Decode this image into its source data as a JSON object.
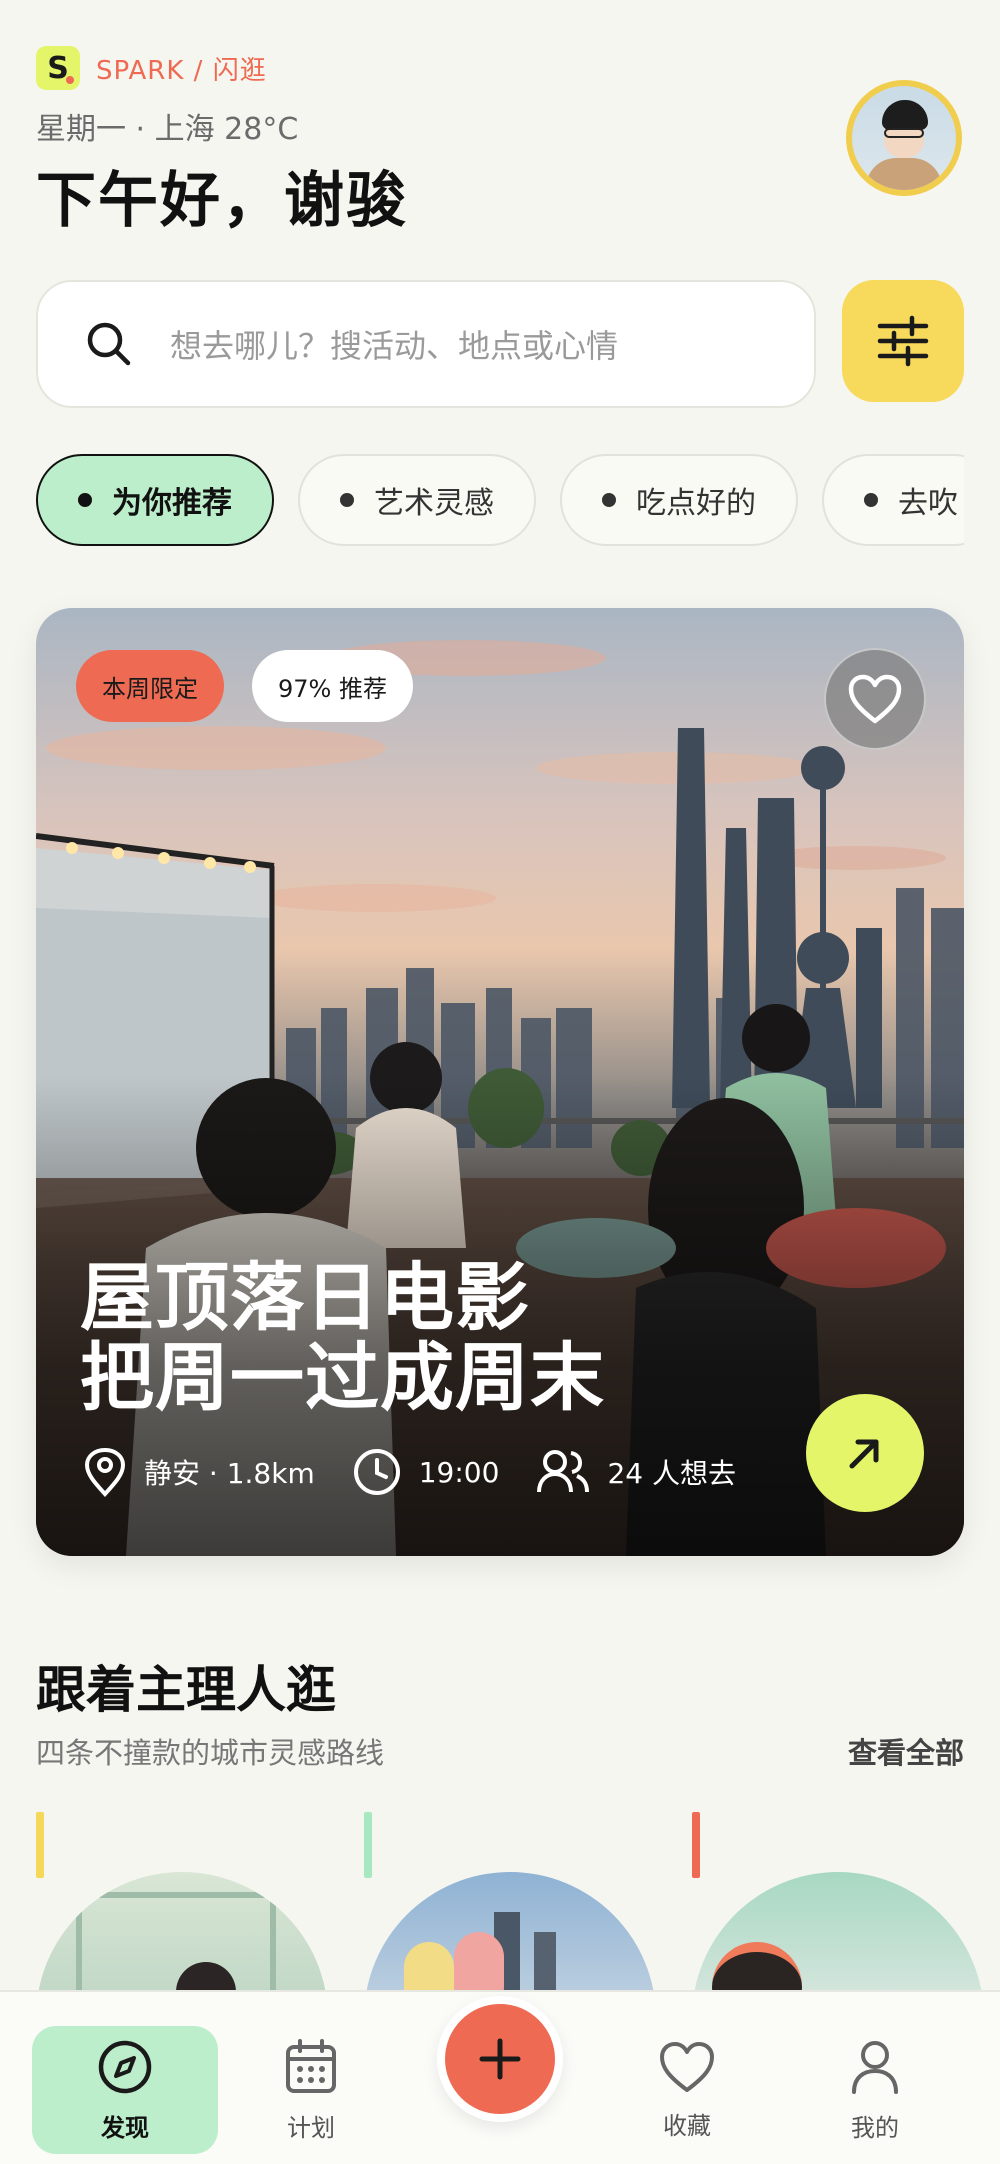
{
  "brand": {
    "name": "SPARK / 闪逛",
    "logo_letter": "S"
  },
  "header": {
    "meta": "星期一 · 上海 28°C",
    "greeting": "下午好，谢骏"
  },
  "search": {
    "placeholder": "想去哪儿？搜活动、地点或心情"
  },
  "chips": [
    {
      "label": "为你推荐",
      "active": true
    },
    {
      "label": "艺术灵感",
      "active": false
    },
    {
      "label": "吃点好的",
      "active": false
    },
    {
      "label": "去吹",
      "active": false
    }
  ],
  "hero": {
    "badge_limited": "本周限定",
    "badge_rec": "97% 推荐",
    "title_line1": "屋顶落日电影",
    "title_line2": "把周一过成周末",
    "location": "静安 · 1.8km",
    "time": "19:00",
    "people": "24 人想去"
  },
  "section": {
    "title": "跟着主理人逛",
    "subtitle": "四条不撞款的城市灵感路线",
    "more": "查看全部"
  },
  "guides": [
    {
      "accent": "#f5d85a"
    },
    {
      "accent": "#a8e8c0"
    },
    {
      "accent": "#ef6a52"
    }
  ],
  "tabs": {
    "discover": "发现",
    "plan": "计划",
    "favorites": "收藏",
    "me": "我的"
  },
  "colors": {
    "accent_lime": "#e4f56a",
    "accent_coral": "#ef6a52",
    "accent_mint": "#bdeecb",
    "accent_yellow": "#f7d95c"
  }
}
